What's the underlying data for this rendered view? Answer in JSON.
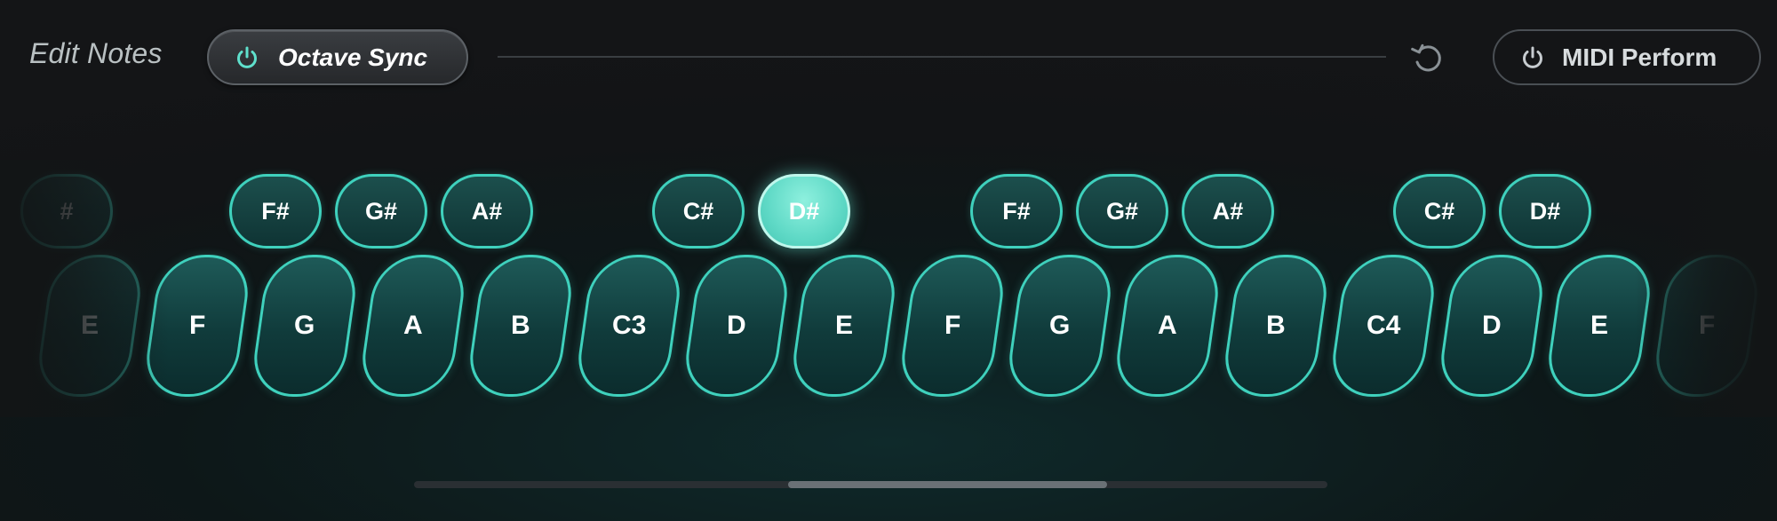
{
  "header": {
    "title": "Edit Notes",
    "octave_sync_label": "Octave Sync",
    "midi_perform_label": "MIDI Perform",
    "icons": {
      "octave_power": "power-icon",
      "undo": "undo-icon",
      "midi_power": "power-icon"
    }
  },
  "keyboard": {
    "accent_color": "#3fd1bd",
    "active_key": "D#",
    "white_keys": [
      "E",
      "F",
      "G",
      "A",
      "B",
      "C3",
      "D",
      "E",
      "F",
      "G",
      "A",
      "B",
      "C4",
      "D",
      "E",
      "F"
    ],
    "black_keys": [
      "#",
      "F#",
      "G#",
      "A#",
      "C#",
      "D#",
      "F#",
      "G#",
      "A#",
      "C#",
      "D#"
    ]
  },
  "scrollbar": {
    "thumb_start_fraction": 0.41,
    "thumb_size_fraction": 0.35
  }
}
